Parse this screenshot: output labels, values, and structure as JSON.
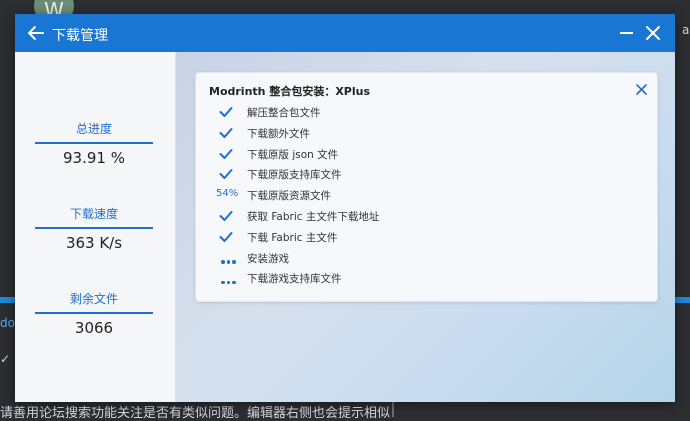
{
  "background": {
    "avatar_letter": "W",
    "left_text": "do",
    "left_mark": "✓",
    "right_text": "a",
    "bottom_text": "请善用论坛搜索功能关注是否有类似问题。编辑器右侧也会提示相似"
  },
  "dialog": {
    "title": "下载管理",
    "back_icon": "arrow-left-icon",
    "minimize_icon": "minimize-icon",
    "close_icon": "close-icon",
    "accent_color": "#1976d2"
  },
  "stats": [
    {
      "label": "总进度",
      "value": "93.91 %"
    },
    {
      "label": "下载速度",
      "value": "363 K/s"
    },
    {
      "label": "剩余文件",
      "value": "3066"
    }
  ],
  "task_card": {
    "title": "Modrinth 整合包安装：XPlus",
    "tasks": [
      {
        "status": "done",
        "label": "解压整合包文件"
      },
      {
        "status": "done",
        "label": "下载额外文件"
      },
      {
        "status": "done",
        "label": "下载原版 json 文件"
      },
      {
        "status": "done",
        "label": "下载原版支持库文件"
      },
      {
        "status": "progress",
        "progress_text": "54%",
        "label": "下载原版资源文件"
      },
      {
        "status": "done",
        "label": "获取 Fabric 主文件下载地址"
      },
      {
        "status": "done",
        "label": "下载 Fabric 主文件"
      },
      {
        "status": "pending",
        "label": "安装游戏"
      },
      {
        "status": "pending",
        "label": "下载游戏支持库文件"
      }
    ]
  }
}
